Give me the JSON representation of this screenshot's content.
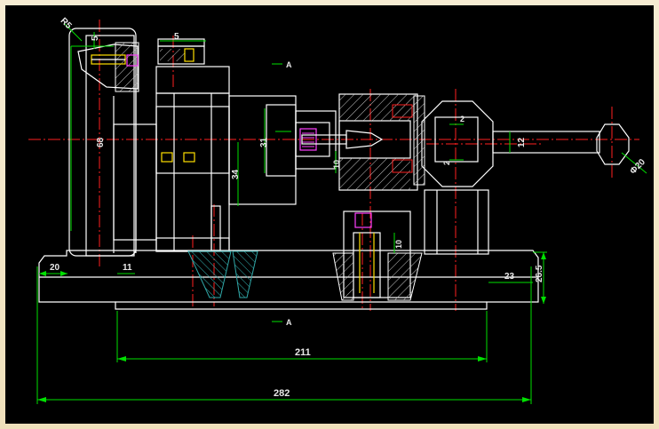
{
  "colors": {
    "background": "#000000",
    "frame": "#f3e7c7",
    "outline": "#ffffff",
    "dimension": "#00e000",
    "centerline": "#ff2020",
    "hatch": "#30a8a8",
    "fastener": "#ff40ff",
    "part": "#ffe000"
  },
  "dimensions": {
    "overall_length": "282",
    "base_inner_length": "211",
    "base_left_step": "20",
    "base_left_inner": "11",
    "base_right_step": "23",
    "right_height": "26.5",
    "wheel_dia": "68",
    "hub_dia_a": "31",
    "hub_dia_b": "34",
    "top_small": "5",
    "top_left_small": "5",
    "chamfer": "R5",
    "knob_dia": "Φ20",
    "handle_dia": "12",
    "cam_small": "2",
    "cam_small_b": "2",
    "center_hole": "10",
    "nut_size": "10",
    "section_top": "A",
    "section_bottom": "A"
  }
}
